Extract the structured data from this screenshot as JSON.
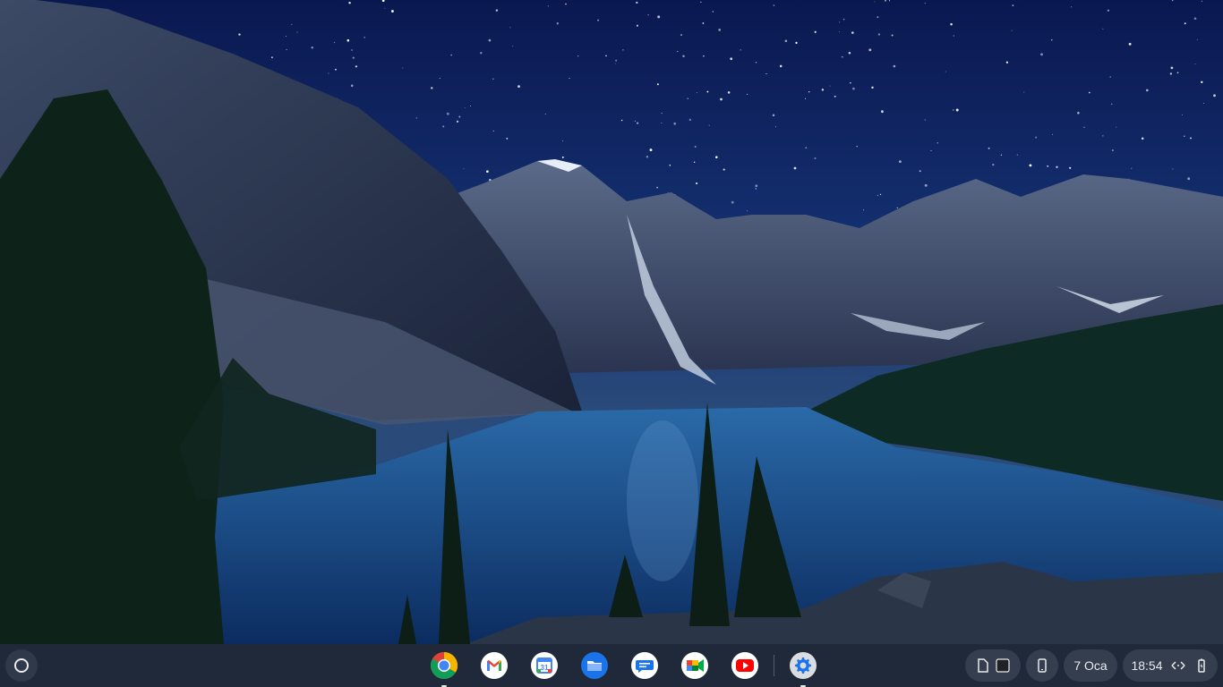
{
  "wallpaper": {
    "description_icon": "mountain-lake-night-wallpaper"
  },
  "shelf": {
    "launcher": {
      "icon": "launcher-circle-icon"
    },
    "apps": [
      {
        "name": "chrome",
        "icon": "chrome-icon",
        "running": true
      },
      {
        "name": "gmail",
        "icon": "gmail-icon",
        "running": false
      },
      {
        "name": "calendar",
        "icon": "calendar-icon",
        "label": "31",
        "running": false
      },
      {
        "name": "files",
        "icon": "files-icon",
        "running": false
      },
      {
        "name": "messages",
        "icon": "messages-icon",
        "running": false
      },
      {
        "name": "meet",
        "icon": "meet-icon",
        "running": false
      },
      {
        "name": "youtube",
        "icon": "youtube-icon",
        "running": false
      },
      {
        "name": "settings",
        "icon": "settings-icon",
        "running": true
      }
    ],
    "tray": {
      "date": "7 Oca",
      "time": "18:54",
      "network_icon": "network-arrows-icon",
      "battery_icon": "battery-icon",
      "phone_icon": "phone-hub-icon",
      "holding_space_icon": "holding-space-icon"
    }
  },
  "colors": {
    "shelf": "#1c2028",
    "sky": "#0b1a4a",
    "lake": "#1a4a8a"
  }
}
